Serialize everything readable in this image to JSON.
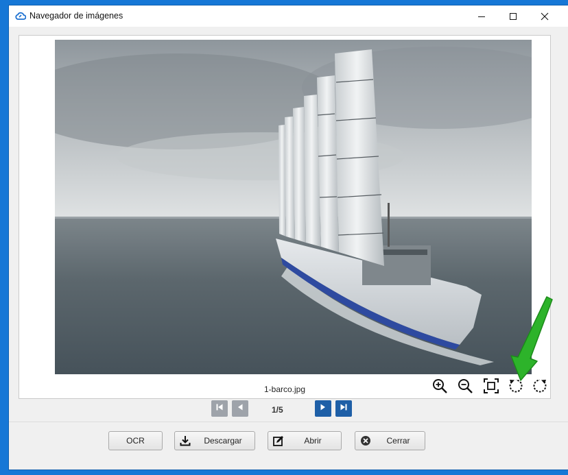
{
  "window": {
    "title": "Navegador de imágenes",
    "app_icon": "cloud-icon",
    "controls": [
      "minimize-icon",
      "maximize-icon",
      "close-icon"
    ]
  },
  "viewer": {
    "image_alt": "Barco con velas rígidas navegando en mar abierto",
    "filename": "1-barco.jpg",
    "tools": [
      "zoom-in-icon",
      "zoom-out-icon",
      "fit-screen-icon",
      "rotate-left-icon",
      "rotate-right-icon"
    ],
    "highlight_color": "#2db32a"
  },
  "pager": {
    "current": "1/5",
    "buttons": [
      "first-page-icon",
      "previous-page-icon",
      "next-page-icon",
      "last-page-icon"
    ]
  },
  "actions": {
    "ocr": "OCR",
    "download": "Descargar",
    "open": "Abrir",
    "close": "Cerrar"
  },
  "colors": {
    "desktop": "#1677d6",
    "nav_active": "#1e5fa7",
    "nav_disabled": "#9ea3aa"
  }
}
